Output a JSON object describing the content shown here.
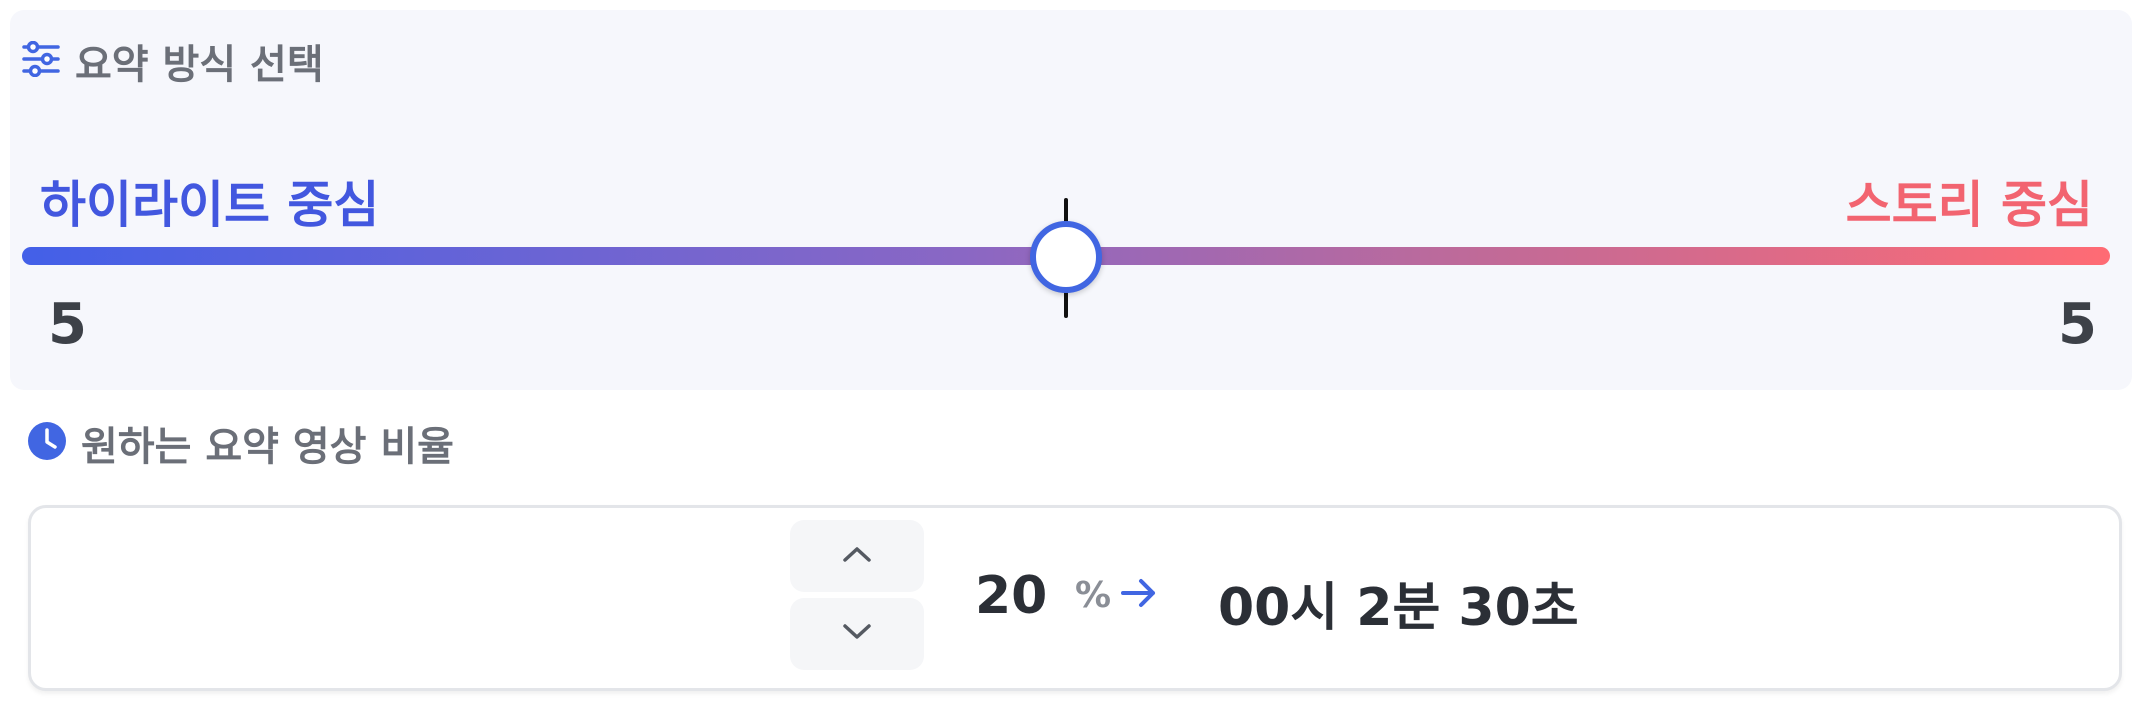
{
  "section1": {
    "title": "요약 방식 선택",
    "icon": "sliders-icon"
  },
  "slider": {
    "left_label": "하이라이트 중심",
    "right_label": "스토리 중심",
    "left_value": "5",
    "right_value": "5",
    "position": 0.5,
    "left_color": "#4257df",
    "right_color": "#f26470"
  },
  "section2": {
    "title": "원하는 요약 영상 비율",
    "icon": "clock-icon"
  },
  "ratio": {
    "value": "20",
    "unit": "%",
    "duration": "00시 2분 30초",
    "up_icon": "chevron-up-icon",
    "down_icon": "chevron-down-icon",
    "arrow_icon": "arrow-right-icon"
  }
}
